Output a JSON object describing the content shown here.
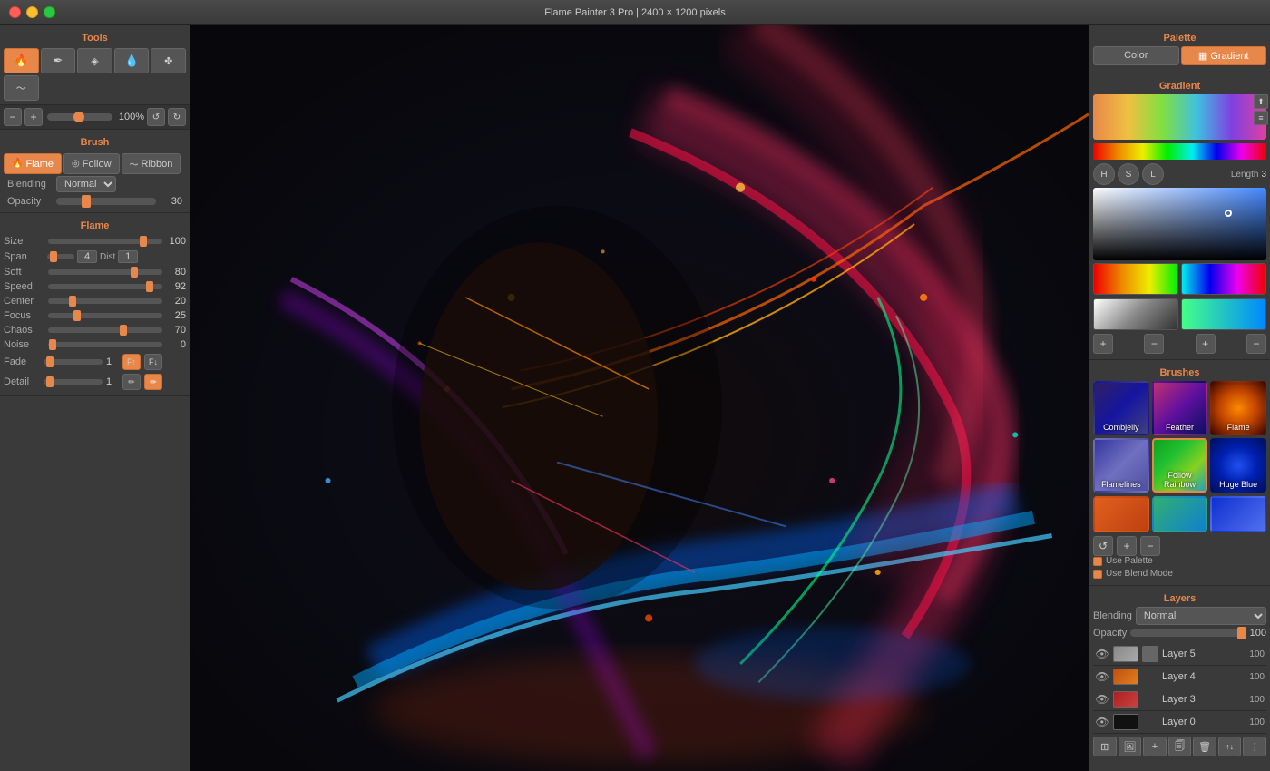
{
  "titlebar": {
    "title": "Flame Painter 3 Pro | 2400 × 1200 pixels"
  },
  "tools": {
    "label": "Tools",
    "items": [
      {
        "name": "flame-tool",
        "icon": "🔥",
        "active": true
      },
      {
        "name": "pen-tool",
        "icon": "✒"
      },
      {
        "name": "stamp-tool",
        "icon": "◈"
      },
      {
        "name": "dropper-tool",
        "icon": "💧"
      },
      {
        "name": "transform-tool",
        "icon": "✤"
      },
      {
        "name": "wave-tool",
        "icon": "〜"
      }
    ],
    "zoom_minus": "−",
    "zoom_plus": "+",
    "zoom_value": "100%",
    "reset_btn": "↺",
    "redo_btn": "↻"
  },
  "brush": {
    "label": "Brush",
    "tabs": [
      {
        "name": "flame-tab",
        "label": "Flame",
        "active": true,
        "icon": "🔥"
      },
      {
        "name": "follow-tab",
        "label": "Follow",
        "active": false,
        "icon": "◎"
      },
      {
        "name": "ribbon-tab",
        "label": "Ribbon",
        "active": false,
        "icon": "〜"
      }
    ],
    "blending_label": "Blending",
    "blending_value": "Normal",
    "opacity_label": "Opacity",
    "opacity_value": "30"
  },
  "flame": {
    "label": "Flame",
    "params": [
      {
        "name": "size",
        "label": "Size",
        "value": "100",
        "pct": 85
      },
      {
        "name": "span",
        "label": "Span",
        "value": "4",
        "pct": 20,
        "has_dist": true,
        "dist_value": "1"
      },
      {
        "name": "soft",
        "label": "Soft",
        "value": "80",
        "pct": 75
      },
      {
        "name": "speed",
        "label": "Speed",
        "value": "92",
        "pct": 88
      },
      {
        "name": "center",
        "label": "Center",
        "value": "20",
        "pct": 20
      },
      {
        "name": "focus",
        "label": "Focus",
        "value": "25",
        "pct": 25
      },
      {
        "name": "chaos",
        "label": "Chaos",
        "value": "70",
        "pct": 65
      },
      {
        "name": "noise",
        "label": "Noise",
        "value": "0",
        "pct": 2
      }
    ],
    "fade_label": "Fade",
    "fade_value": "1",
    "detail_label": "Detail",
    "detail_value": "1"
  },
  "palette": {
    "label": "Palette",
    "tabs": [
      {
        "name": "color-tab",
        "label": "Color",
        "active": false
      },
      {
        "name": "gradient-tab",
        "label": "Gradient",
        "active": true,
        "icon": "▦"
      }
    ],
    "gradient_label": "Gradient",
    "length_label": "Length",
    "length_value": "3",
    "hsl": [
      "H",
      "S",
      "L"
    ]
  },
  "brushes": {
    "label": "Brushes",
    "items": [
      {
        "name": "combjelly",
        "label": "Combjelly",
        "selected": false,
        "bg": "linear-gradient(135deg, #6040a0, #2020a0)"
      },
      {
        "name": "feather",
        "label": "Feather",
        "selected": false,
        "bg": "linear-gradient(135deg, #e05090, #8020a0, #102080)"
      },
      {
        "name": "flame-brush",
        "label": "Flame",
        "selected": false,
        "bg": "linear-gradient(135deg, #e05010, #e0a020, #802000)"
      },
      {
        "name": "flamelines",
        "label": "Flamelines",
        "selected": false,
        "bg": "linear-gradient(135deg, #4040a0, #8080c0, #6060a0)"
      },
      {
        "name": "follow-rainbow",
        "label": "Follow Rainbow",
        "selected": true,
        "bg": "linear-gradient(135deg, #20a020, #40d040, #a0e040, #40b0d0)"
      },
      {
        "name": "huge-blue",
        "label": "Huge Blue",
        "selected": false,
        "bg": "linear-gradient(135deg, #1030d0, #2060f0, #0020a0)"
      }
    ],
    "sub_items": [
      {
        "name": "sub1",
        "bg": "linear-gradient(135deg, #e06020, #c04010)"
      },
      {
        "name": "sub2",
        "bg": "linear-gradient(135deg, #40c080, #20a0e0)"
      },
      {
        "name": "sub3",
        "bg": "linear-gradient(135deg, #2040e0, #6080f0)"
      }
    ],
    "use_palette_label": "Use Palette",
    "use_blend_label": "Use Blend Mode"
  },
  "layers": {
    "label": "Layers",
    "blending_label": "Blending",
    "blending_value": "Normal",
    "opacity_label": "Opacity",
    "opacity_value": "100",
    "items": [
      {
        "name": "Layer 5",
        "opacity": "100",
        "eye": true,
        "thumb_color": "#888"
      },
      {
        "name": "Layer 4",
        "opacity": "100",
        "eye": true,
        "thumb_color": "#e07030"
      },
      {
        "name": "Layer 3",
        "opacity": "100",
        "eye": true,
        "thumb_color": "#c04040"
      },
      {
        "name": "Layer 0",
        "opacity": "100",
        "eye": true,
        "thumb_color": "#111"
      }
    ],
    "toolbar_btns": [
      "⊞",
      "🖼",
      "+",
      "🗐",
      "🗑",
      "↑↓",
      "⋮"
    ]
  }
}
